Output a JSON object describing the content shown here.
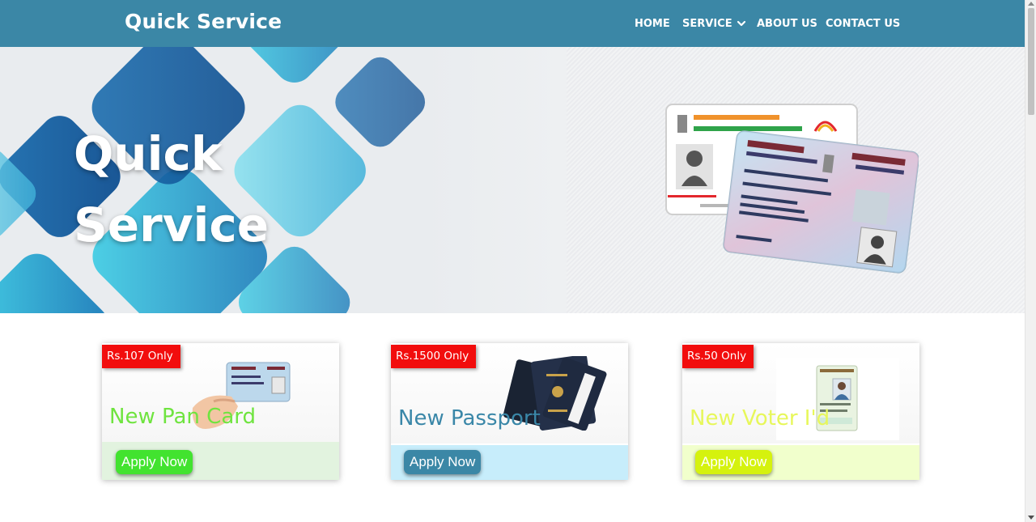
{
  "nav": {
    "brand": "Quick Service",
    "items": [
      {
        "label": "HOME"
      },
      {
        "label": "SERVICE"
      },
      {
        "label": "ABOUT US"
      },
      {
        "label": "CONTACT US"
      }
    ]
  },
  "hero": {
    "title_line1": "Quick",
    "title_line2": "Service"
  },
  "cards": [
    {
      "price": "Rs.107 Only",
      "name": "New Pan Card",
      "button": "Apply Now"
    },
    {
      "price": "Rs.1500 Only",
      "name": "New Passport",
      "button": "Apply Now"
    },
    {
      "price": "Rs.50 Only",
      "name": "New Voter I'd",
      "button": "Apply Now"
    }
  ],
  "colors": {
    "navbar": "#3b87a6",
    "accent_red": "#e8151b",
    "price_badge": "#f20d0d",
    "pan_green": "#42e32f",
    "passport_blue": "#3b87a6",
    "voter_yellow": "#d5f20e"
  },
  "icons": {
    "service_dropdown": "chevron-down-icon",
    "hero_illustration": "id-cards-illustration"
  }
}
